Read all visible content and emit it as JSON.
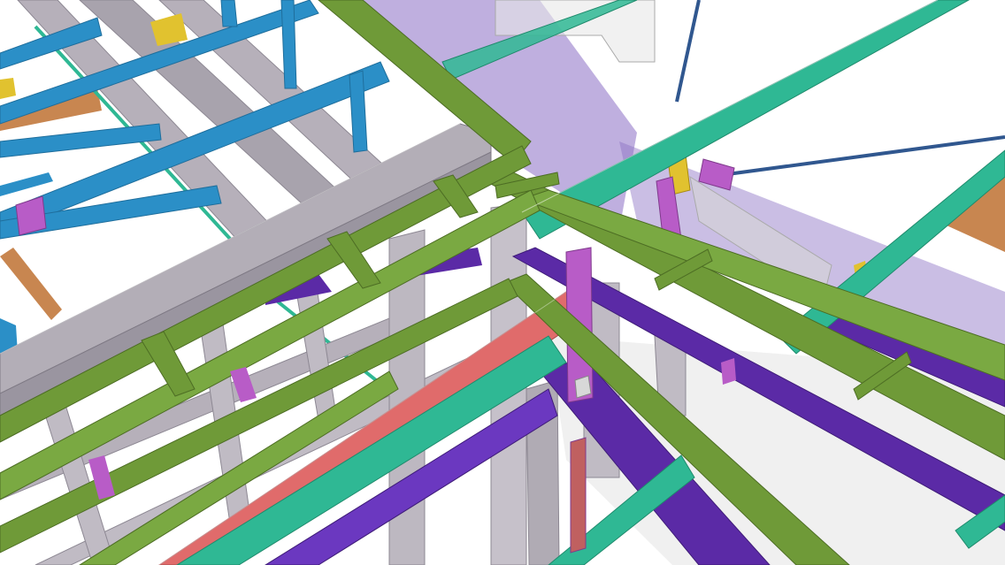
{
  "scene": {
    "kind": "3d-structural-steel-model-render",
    "background": "#ffffff",
    "member_colors": {
      "green_beams": "#6f9a38",
      "teal_beams": "#2fb894",
      "blue_trusses": "#2b8fc7",
      "grey_columns": "#a8a3ad",
      "purple_beams": "#5b2aa6",
      "red_beam": "#e06b6b",
      "magenta_plates": "#b85cc7",
      "orange_wood": "#c88650",
      "yellow_brackets": "#e1c22f",
      "translucent_wall": "#8a6ec4",
      "navy_rods": "#30578f"
    }
  }
}
